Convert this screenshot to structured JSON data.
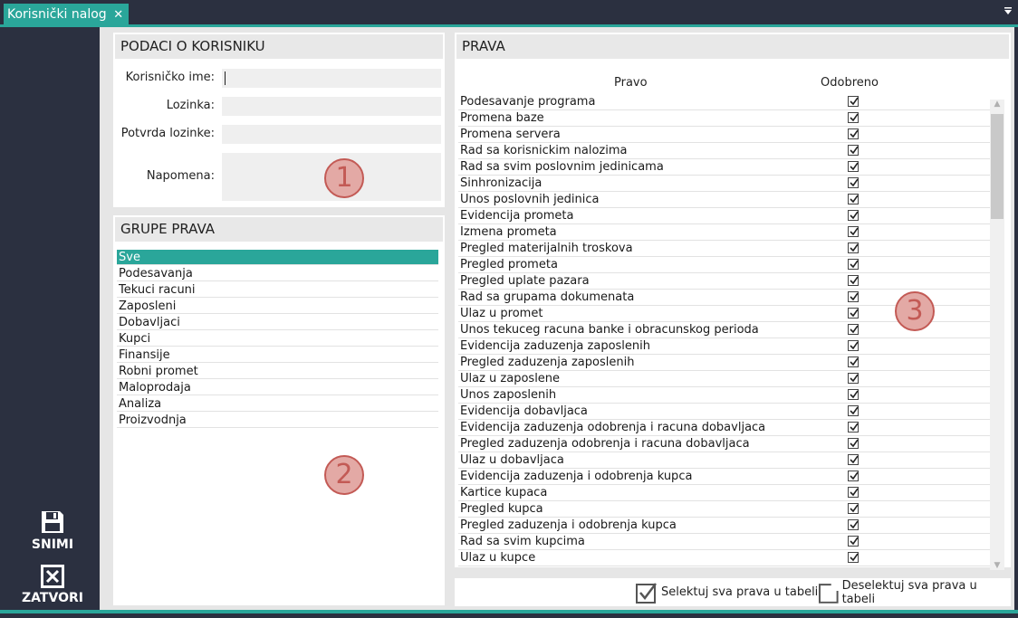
{
  "tab": {
    "title": "Korisnički nalog",
    "close": "✕"
  },
  "menu_icon": "menu-arrow-icon",
  "sidebar": {
    "save_label": "SNIMI",
    "close_label": "ZATVORI"
  },
  "user_panel": {
    "header": "PODACI O KORISNIKU",
    "username_label": "Korisničko ime:",
    "password_label": "Lozinka:",
    "confirm_label": "Potvrda lozinke:",
    "note_label": "Napomena:",
    "username_value": "",
    "password_value": "",
    "confirm_value": "",
    "note_value": "",
    "badge": "1"
  },
  "groups_panel": {
    "header": "GRUPE PRAVA",
    "badge": "2",
    "items": [
      "Sve",
      "Podesavanja",
      "Tekuci racuni",
      "Zaposleni",
      "Dobavljaci",
      "Kupci",
      "Finansije",
      "Robni promet",
      "Maloprodaja",
      "Analiza",
      "Proizvodnja"
    ],
    "selected": "Sve"
  },
  "rights_panel": {
    "header": "PRAVA",
    "badge": "3",
    "col_right": "Pravo",
    "col_approved": "Odobreno",
    "rows": [
      "Podesavanje programa",
      "Promena baze",
      "Promena servera",
      "Rad sa korisnickim nalozima",
      "Rad sa svim poslovnim jedinicama",
      "Sinhronizacija",
      "Unos poslovnih jedinica",
      "Evidencija prometa",
      "Izmena prometa",
      "Pregled materijalnih troskova",
      "Pregled prometa",
      "Pregled uplate pazara",
      "Rad sa grupama dokumenata",
      "Ulaz u promet",
      "Unos tekuceg racuna banke i obracunskog perioda",
      "Evidencija zaduzenja zaposlenih",
      "Pregled zaduzenja zaposlenih",
      "Ulaz u zaposlene",
      "Unos zaposlenih",
      "Evidencija dobavljaca",
      "Evidencija zaduzenja odobrenja i racuna dobavljaca",
      "Pregled zaduzenja odobrenja i racuna dobavljaca",
      "Ulaz u dobavljaca",
      "Evidencija zaduzenja i odobrenja kupca",
      "Kartice kupaca",
      "Pregled kupca",
      "Pregled zaduzenja i odobrenja kupca",
      "Rad sa svim kupcima",
      "Ulaz u kupce"
    ],
    "all_checked": true
  },
  "footer": {
    "select_all": "Selektuj sva prava u tabeli",
    "deselect_all": "Deselektuj sva prava u tabeli"
  },
  "colors": {
    "accent": "#2aa69a",
    "sidebar": "#2b3040",
    "badge": "#c35a55"
  }
}
